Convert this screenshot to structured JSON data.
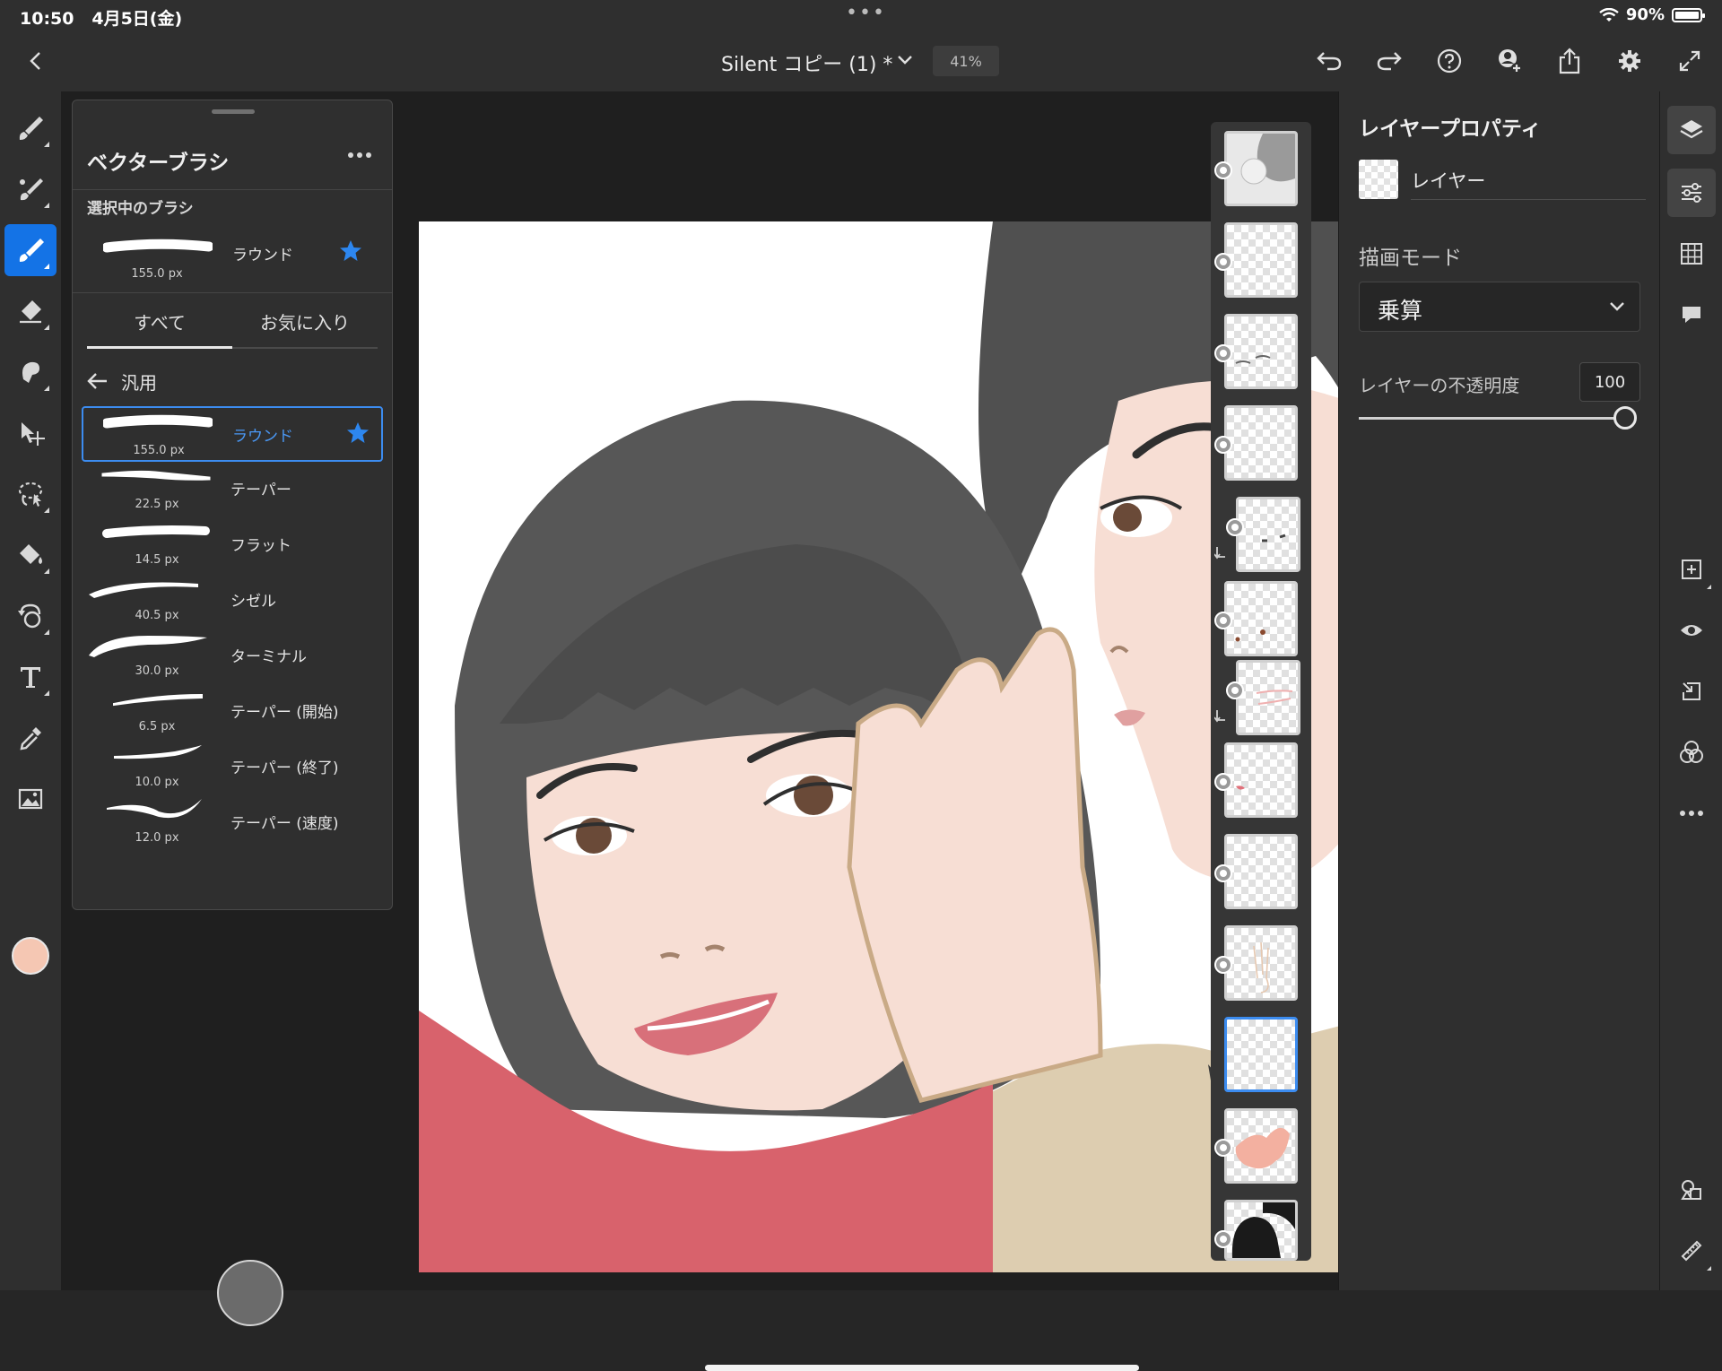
{
  "status_bar": {
    "time": "10:50",
    "date": "4月5日(金)",
    "battery": "90%"
  },
  "header": {
    "title": "Silent コピー (1) *",
    "zoom": "41%"
  },
  "colors": {
    "accent": "#1473e6",
    "current_color": "#f5c7b3"
  },
  "brush_panel": {
    "title": "ベクターブラシ",
    "current_label": "選択中のブラシ",
    "current": {
      "name": "ラウンド",
      "size": "155.0 px"
    },
    "tabs": [
      {
        "label": "すべて"
      },
      {
        "label": "お気に入り"
      }
    ],
    "category": "汎用",
    "brushes": [
      {
        "name": "ラウンド",
        "size": "155.0 px"
      },
      {
        "name": "テーパー",
        "size": "22.5 px"
      },
      {
        "name": "フラット",
        "size": "14.5 px"
      },
      {
        "name": "シゼル",
        "size": "40.5 px"
      },
      {
        "name": "ターミナル",
        "size": "30.0 px"
      },
      {
        "name": "テーパー (開始)",
        "size": "6.5 px"
      },
      {
        "name": "テーパー (終了)",
        "size": "10.0 px"
      },
      {
        "name": "テーパー (速度)",
        "size": "12.0 px"
      }
    ]
  },
  "properties": {
    "title": "レイヤープロパティ",
    "layer_name": "レイヤー",
    "blend_label": "描画モード",
    "blend_value": "乗算",
    "opacity_label": "レイヤーの不透明度",
    "opacity_value": "100"
  }
}
